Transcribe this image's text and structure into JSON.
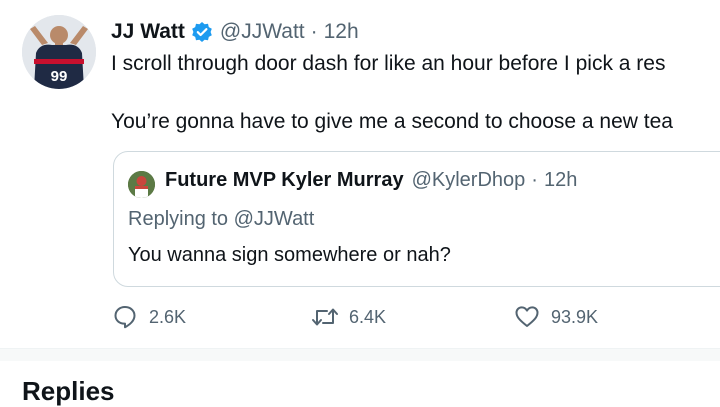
{
  "tweet": {
    "author_name": "JJ Watt",
    "handle": "@JJWatt",
    "separator": "·",
    "time": "12h",
    "text_line1": "I scroll through door dash for like an hour before I pick a res",
    "text_line2": "You’re gonna have to give me a second to choose a new tea",
    "avatar_icon": "player-avatar-icon",
    "jersey_number": "99",
    "verified_icon": "verified-badge-icon",
    "accent_color": "#1d9bf0"
  },
  "quoted_tweet": {
    "author_name": "Future MVP Kyler Murray",
    "handle": "@KylerDhop",
    "separator": "·",
    "time": "12h",
    "replying_prefix": "Replying to",
    "replying_mention": "@JJWatt",
    "text": "You wanna sign somewhere or nah?"
  },
  "actions": {
    "reply_count": "2.6K",
    "retweet_count": "6.4K",
    "like_count": "93.9K"
  },
  "replies": {
    "heading": "Replies"
  }
}
